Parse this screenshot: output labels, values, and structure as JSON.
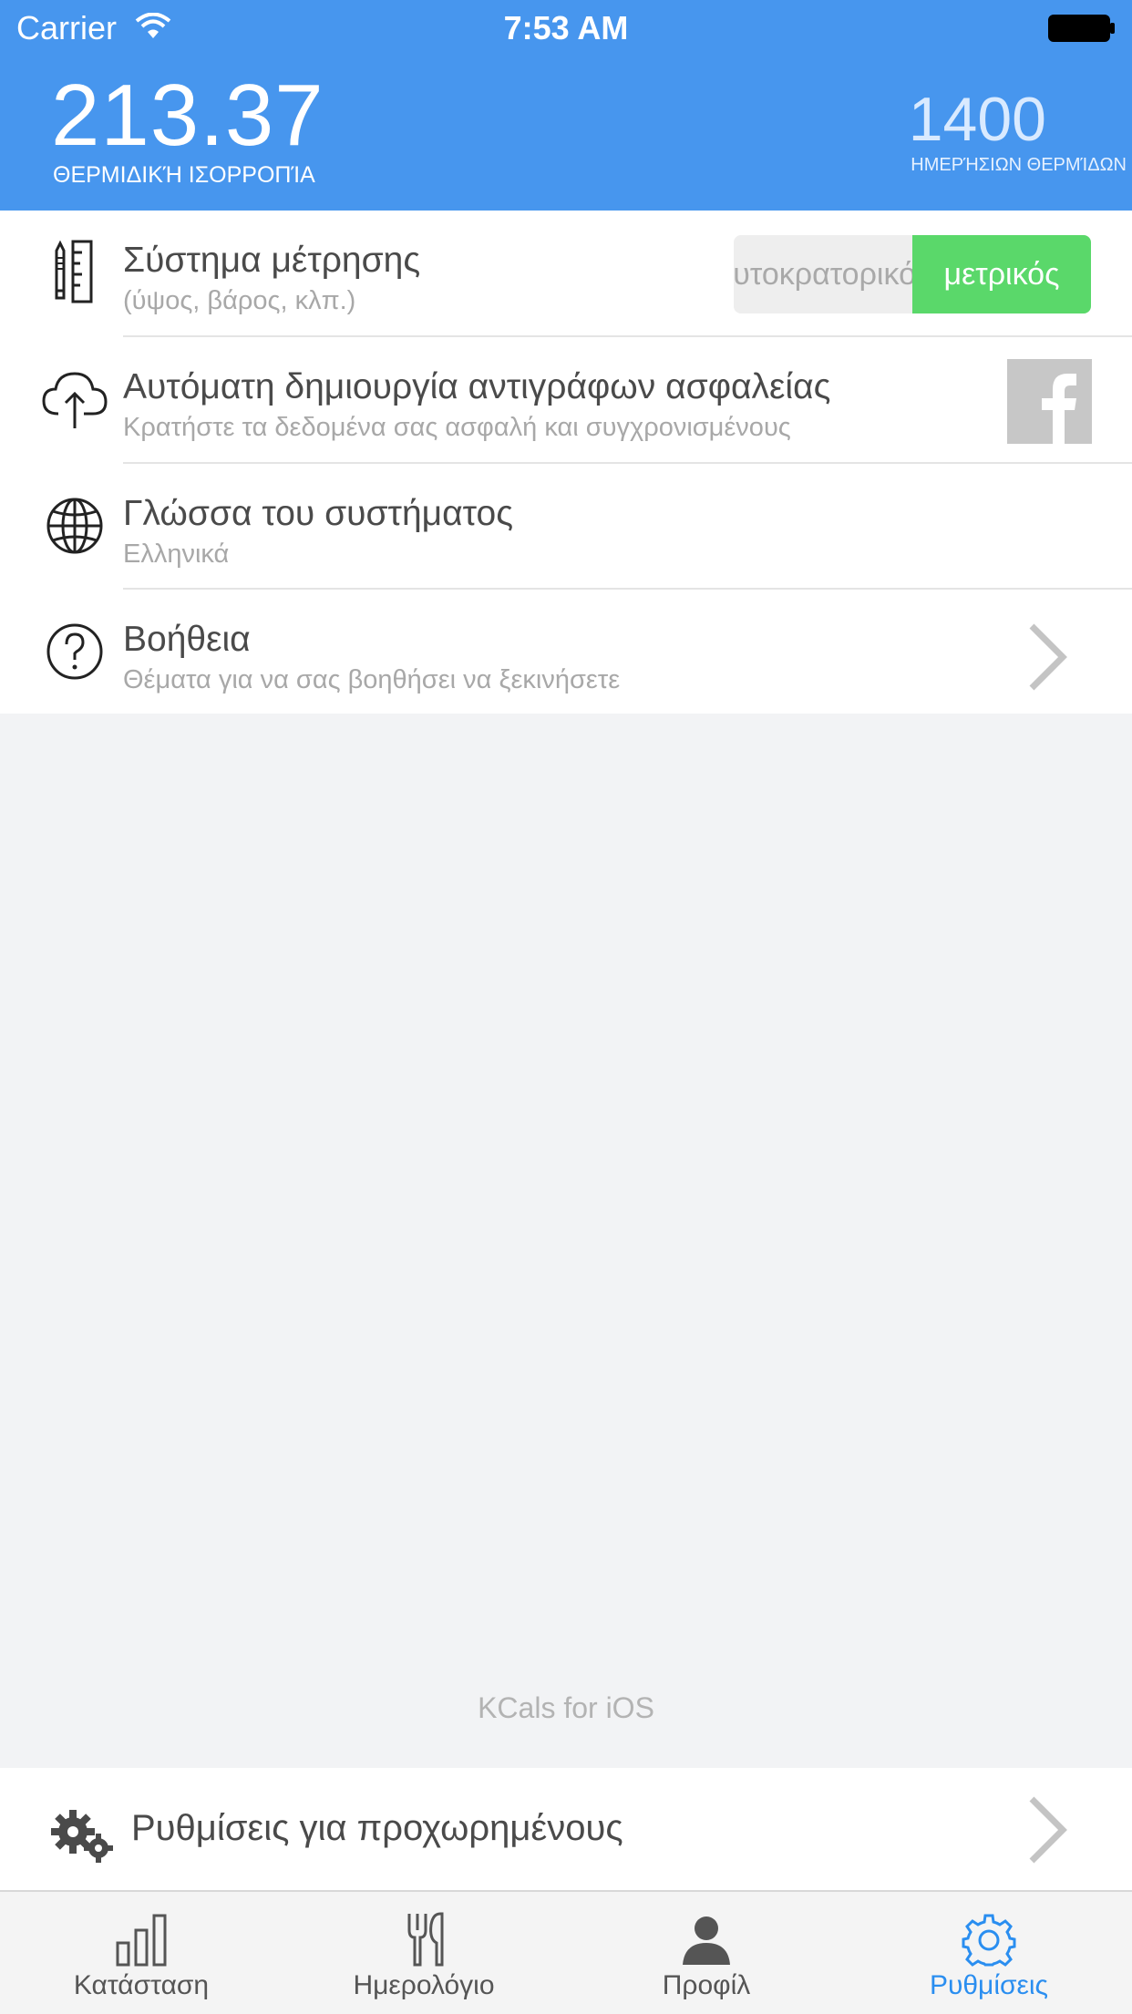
{
  "status_bar": {
    "carrier": "Carrier",
    "time": "7:53 AM"
  },
  "header": {
    "balance_value": "213.37",
    "balance_label": "ΘΕΡΜΙΔΙΚΉ ΙΣΟΡΡΟΠΊΑ",
    "daily_value": "1400",
    "daily_label": "ΗΜΕΡΉΣΙΩΝ ΘΕΡΜΊΔΩΝ"
  },
  "settings": {
    "units": {
      "title": "Σύστημα μέτρησης",
      "subtitle": "(ύψος, βάρος, κλπ.)",
      "option_imperial": "αυτοκρατορικός",
      "option_metric": "μετρικός",
      "selected": "μετρικός"
    },
    "backup": {
      "title": "Αυτόματη δημιουργία αντιγράφων ασφαλείας",
      "subtitle": "Κρατήστε τα δεδομένα σας ασφαλή και συγχρονισμένους"
    },
    "language": {
      "title": "Γλώσσα του συστήματος",
      "subtitle": "Ελληνικά"
    },
    "help": {
      "title": "Βοήθεια",
      "subtitle": "Θέματα για να σας βοηθήσει να ξεκινήσετε"
    }
  },
  "footer_caption": "KCals for iOS",
  "advanced": {
    "title": "Ρυθμίσεις για προχωρημένους"
  },
  "tabbar": {
    "tabs": [
      {
        "label": "Κατάσταση",
        "icon": "bar-chart-icon"
      },
      {
        "label": "Ημερολόγιο",
        "icon": "fork-knife-icon"
      },
      {
        "label": "Προφίλ",
        "icon": "person-icon"
      },
      {
        "label": "Ρυθμίσεις",
        "icon": "gear-icon"
      }
    ],
    "active": "Ρυθμίσεις"
  },
  "colors": {
    "header_bg": "#4796ee",
    "accent_green": "#5ad86a",
    "tab_active": "#2a8ef0"
  }
}
